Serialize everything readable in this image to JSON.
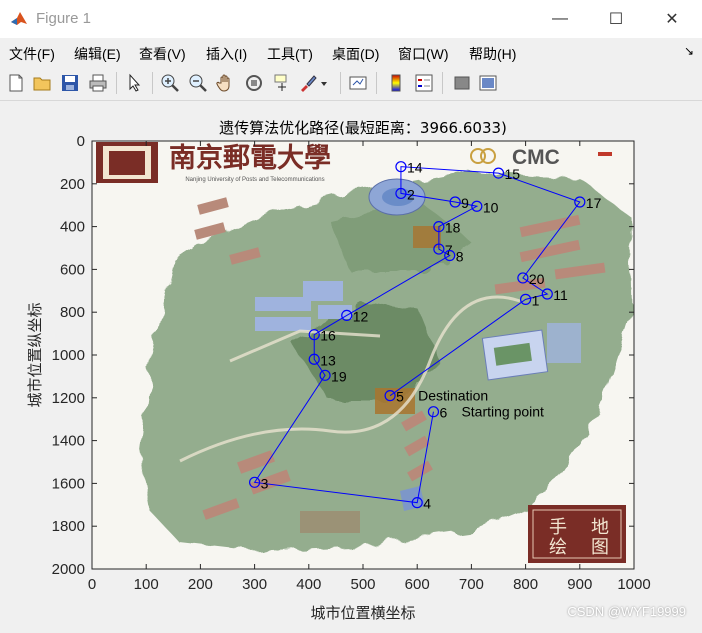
{
  "window": {
    "title": "Figure 1",
    "minimize_glyph": "—",
    "maximize_glyph": "☐",
    "close_glyph": "✕"
  },
  "menu": {
    "items": [
      "文件(F)",
      "编辑(E)",
      "查看(V)",
      "插入(I)",
      "工具(T)",
      "桌面(D)",
      "窗口(W)",
      "帮助(H)"
    ],
    "dock_glyph": "↘"
  },
  "toolbar": {
    "icons": [
      "new-figure-icon",
      "open-file-icon",
      "save-icon",
      "print-icon",
      "pointer-icon",
      "zoom-in-icon",
      "zoom-out-icon",
      "pan-hand-icon",
      "rotate-3d-icon",
      "data-cursor-icon",
      "brush-icon",
      "brush-dropdown-icon",
      "link-plot-icon",
      "colorbar-icon",
      "legend-icon",
      "hide-plot-tools-icon",
      "show-plot-tools-icon"
    ]
  },
  "map_image": {
    "header_text": "南京郵電大學",
    "header_subtext": "Nanjing University of Posts and Telecommunications",
    "cmc_text": "CMC",
    "seal_text": "手 地 绘 图",
    "seal_chars": [
      "手",
      "地",
      "绘",
      "图"
    ]
  },
  "watermark": "CSDN @WYF19999",
  "colors": {
    "route_line": "#0000ff",
    "axes_text": "#262626"
  },
  "chart_data": {
    "type": "line",
    "title": "遗传算法优化路径(最短距离：3966.6033)",
    "xlabel": "城市位置横坐标",
    "ylabel": "城市位置纵坐标",
    "xlim": [
      0,
      1000
    ],
    "ylim": [
      0,
      2000
    ],
    "y_reversed": true,
    "xticks": [
      0,
      100,
      200,
      300,
      400,
      500,
      600,
      700,
      800,
      900,
      1000
    ],
    "yticks": [
      0,
      200,
      400,
      600,
      800,
      1000,
      1200,
      1400,
      1600,
      1800,
      2000
    ],
    "grid": false,
    "cities": [
      {
        "id": 1,
        "x": 800,
        "y": 740
      },
      {
        "id": 2,
        "x": 570,
        "y": 245
      },
      {
        "id": 3,
        "x": 300,
        "y": 1595
      },
      {
        "id": 4,
        "x": 600,
        "y": 1690
      },
      {
        "id": 5,
        "x": 550,
        "y": 1190
      },
      {
        "id": 6,
        "x": 630,
        "y": 1265
      },
      {
        "id": 7,
        "x": 640,
        "y": 505
      },
      {
        "id": 8,
        "x": 660,
        "y": 535
      },
      {
        "id": 9,
        "x": 670,
        "y": 285
      },
      {
        "id": 10,
        "x": 710,
        "y": 305
      },
      {
        "id": 11,
        "x": 840,
        "y": 715
      },
      {
        "id": 12,
        "x": 470,
        "y": 815
      },
      {
        "id": 13,
        "x": 410,
        "y": 1020
      },
      {
        "id": 14,
        "x": 570,
        "y": 120
      },
      {
        "id": 15,
        "x": 750,
        "y": 150
      },
      {
        "id": 16,
        "x": 410,
        "y": 905
      },
      {
        "id": 17,
        "x": 900,
        "y": 285
      },
      {
        "id": 18,
        "x": 640,
        "y": 400
      },
      {
        "id": 19,
        "x": 430,
        "y": 1095
      },
      {
        "id": 20,
        "x": 795,
        "y": 640
      }
    ],
    "route": [
      6,
      4,
      3,
      19,
      13,
      16,
      12,
      8,
      7,
      18,
      10,
      9,
      2,
      14,
      15,
      17,
      20,
      11,
      1,
      5
    ],
    "annotations": [
      {
        "text": "Destination",
        "city": 5
      },
      {
        "text": "Starting point",
        "city": 6
      }
    ]
  }
}
